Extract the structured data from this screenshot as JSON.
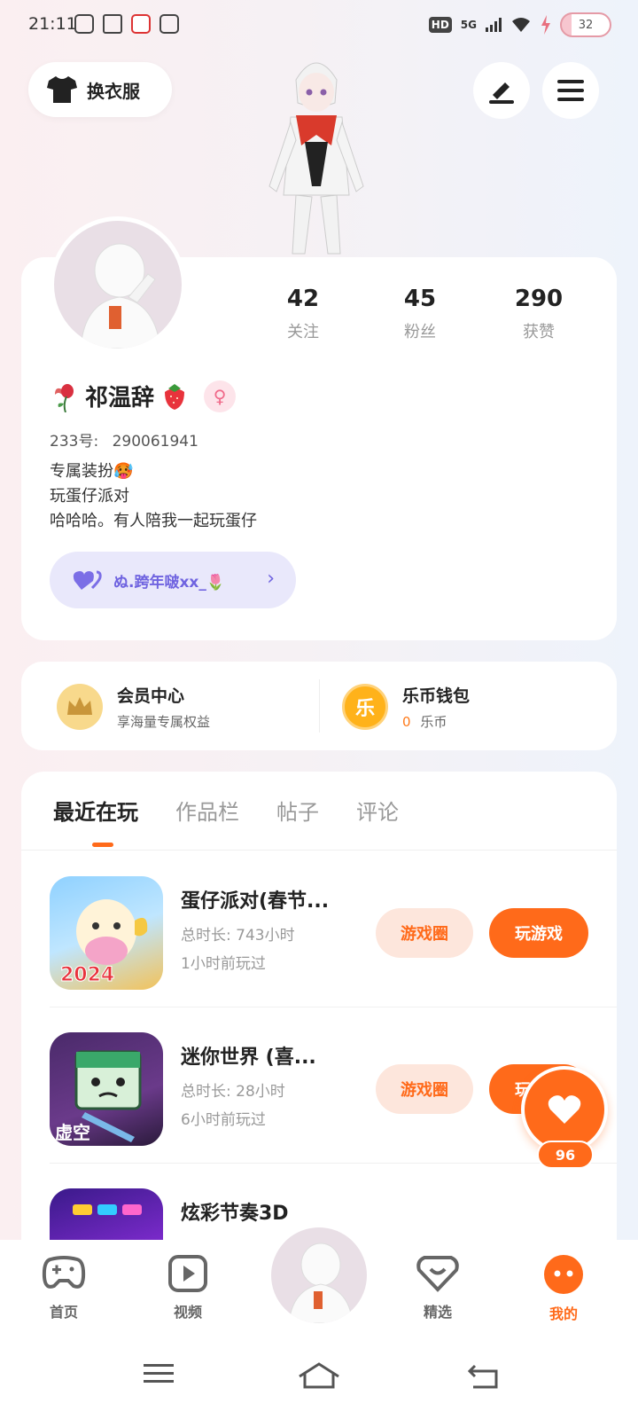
{
  "status_bar": {
    "time": "21:11",
    "hd": "HD",
    "network": "5G",
    "battery": "32"
  },
  "header": {
    "outfit_label": "换衣服"
  },
  "profile": {
    "stats": [
      {
        "num": "42",
        "label": "关注"
      },
      {
        "num": "45",
        "label": "粉丝"
      },
      {
        "num": "290",
        "label": "获赞"
      }
    ],
    "name": "祁温辞",
    "id_label": "233号:",
    "id_value": "290061941",
    "bio": [
      "专属装扮🥵",
      "玩蛋仔派对",
      "哈哈哈。有人陪我一起玩蛋仔"
    ],
    "partner": "ぬ.跨年啵xx_🌷"
  },
  "wallet": {
    "vip_title": "会员中心",
    "vip_sub": "享海量专属权益",
    "coin_title": "乐币钱包",
    "coin_amount": "0",
    "coin_unit": "乐币",
    "coin_icon_text": "乐"
  },
  "tabs": [
    "最近在玩",
    "作品栏",
    "帖子",
    "评论"
  ],
  "games": [
    {
      "name": "蛋仔派对(春节...",
      "total": "总时长: 743小时",
      "last": "1小时前玩过",
      "circle_btn": "游戏圈",
      "play_btn": "玩游戏",
      "badge": "2024"
    },
    {
      "name": "迷你世界 (喜...",
      "total": "总时长: 28小时",
      "last": "6小时前玩过",
      "circle_btn": "游戏圈",
      "play_btn": "玩游戏",
      "badge": "虚空"
    },
    {
      "name": "炫彩节奏3D",
      "total": "",
      "last": "",
      "circle_btn": "",
      "play_btn": "",
      "badge": ""
    }
  ],
  "fab_count": "96",
  "nav": [
    {
      "label": "首页"
    },
    {
      "label": "视频"
    },
    {
      "label": "精选"
    },
    {
      "label": "我的"
    }
  ],
  "colors": {
    "accent": "#ff6a1a",
    "partner_text": "#6f63e0",
    "partner_bg": "#e9e8fb"
  }
}
